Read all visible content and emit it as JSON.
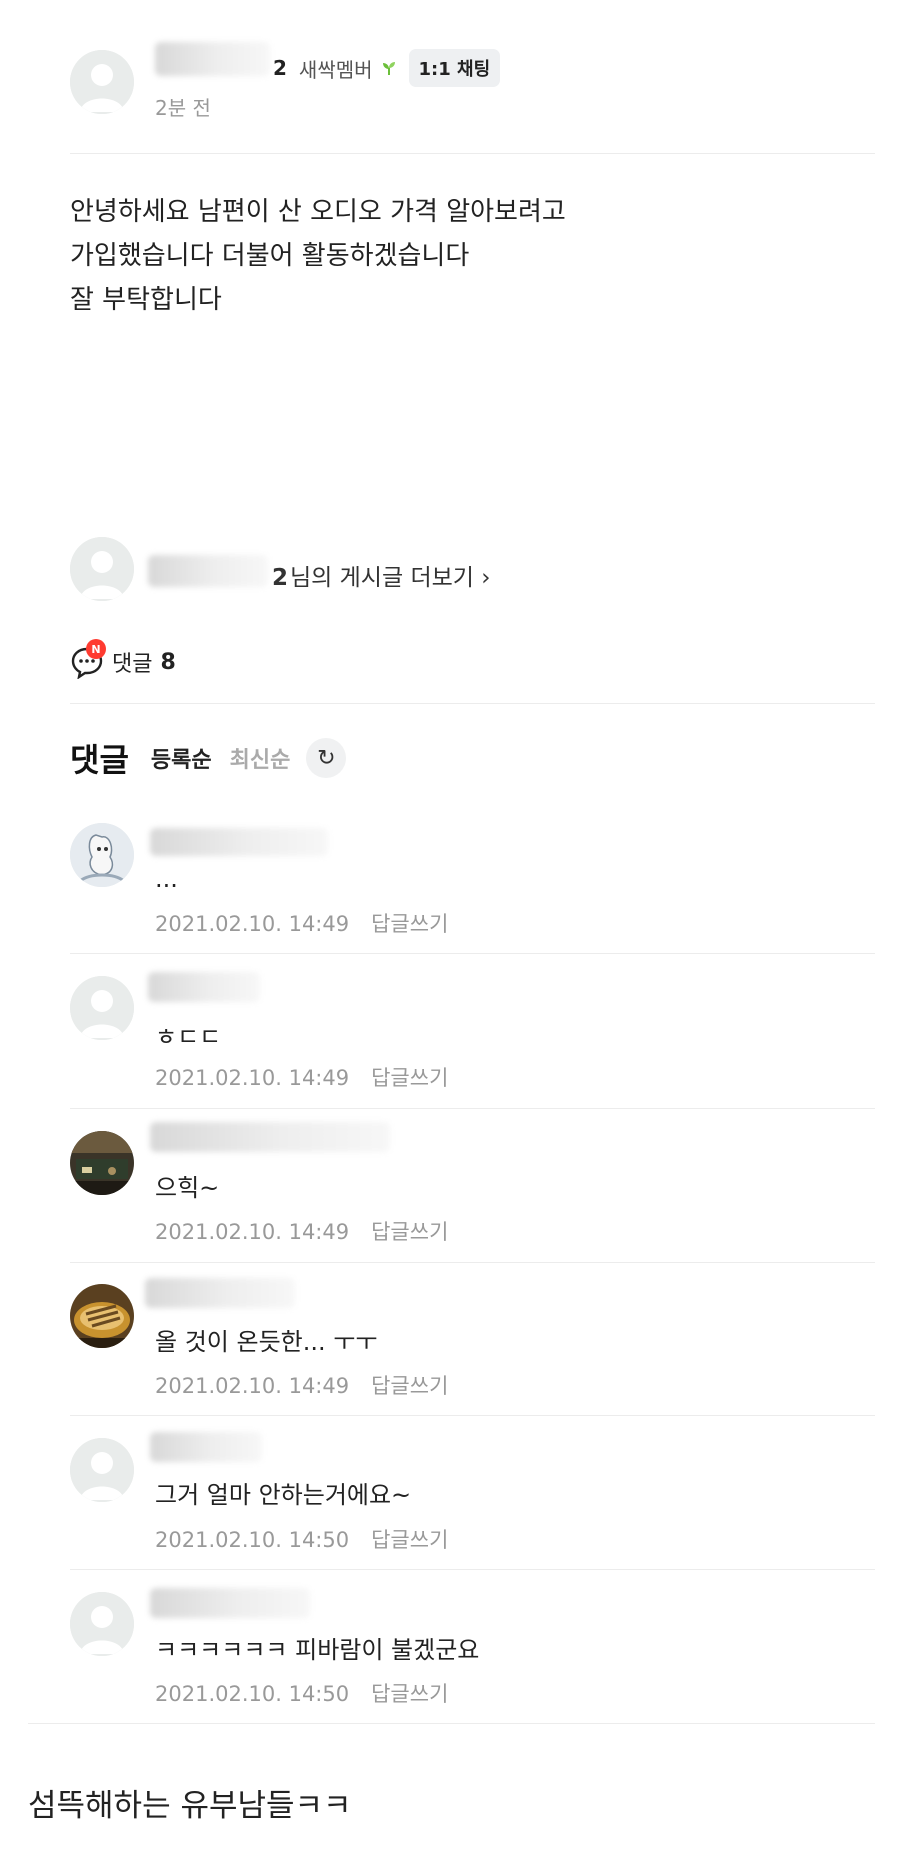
{
  "post": {
    "author_suffix": "2",
    "member_level": "새싹멤버",
    "chat_button": "1:1 채팅",
    "time": "2분 전",
    "body_lines": [
      "안녕하세요 남편이 산 오디오 가격 알아보려고",
      "가입했습니다 더불어 활동하겠습니다",
      "잘 부탁합니다"
    ],
    "more_link_suffix": "2",
    "more_link_text": "님의 게시글 더보기 ›"
  },
  "comment_summary": {
    "new_badge": "N",
    "label": "댓글",
    "count": "8"
  },
  "sort": {
    "title": "댓글",
    "option_registered": "등록순",
    "option_latest": "최신순",
    "refresh_icon": "↻"
  },
  "comments": [
    {
      "text": "...",
      "date": "2021.02.10. 14:49",
      "reply": "답글쓰기"
    },
    {
      "text": "ㅎㄷㄷ",
      "date": "2021.02.10. 14:49",
      "reply": "답글쓰기"
    },
    {
      "text": "으힉~",
      "date": "2021.02.10. 14:49",
      "reply": "답글쓰기"
    },
    {
      "text": "올 것이 온듯한... ㅜㅜ",
      "date": "2021.02.10. 14:49",
      "reply": "답글쓰기"
    },
    {
      "text": "그거 얼마 안하는거에요~",
      "date": "2021.02.10. 14:50",
      "reply": "답글쓰기"
    },
    {
      "text": "ㅋㅋㅋㅋㅋㅋ 피바람이 불겠군요",
      "date": "2021.02.10. 14:50",
      "reply": "답글쓰기"
    }
  ],
  "footer_caption": "섬뜩해하는 유부남들ㅋㅋ",
  "colors": {
    "accent_green": "#6bbf3a",
    "new_badge_red": "#ff3b30",
    "muted_text": "#999999"
  }
}
